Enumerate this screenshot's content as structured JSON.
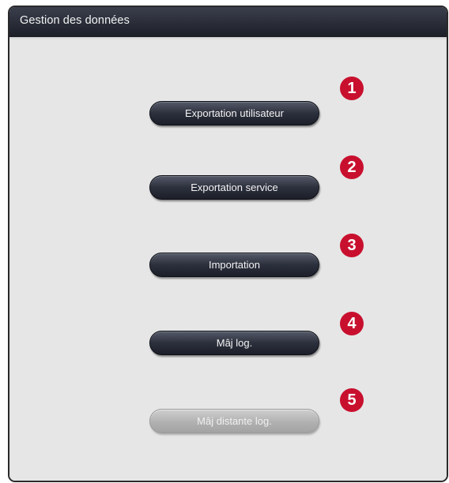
{
  "window": {
    "title": "Gestion des données"
  },
  "buttons": [
    {
      "label": "Exportation utilisateur",
      "enabled": true
    },
    {
      "label": "Exportation service",
      "enabled": true
    },
    {
      "label": "Importation",
      "enabled": true
    },
    {
      "label": "Mâj log.",
      "enabled": true
    },
    {
      "label": "Mâj distante log.",
      "enabled": false
    }
  ],
  "callouts": [
    "1",
    "2",
    "3",
    "4",
    "5"
  ],
  "colors": {
    "titlebar": "#1b1e27",
    "panel": "#e6e6e6",
    "button": "#2c303d",
    "button_disabled": "#b1b1b1",
    "callout": "#c8102e"
  }
}
